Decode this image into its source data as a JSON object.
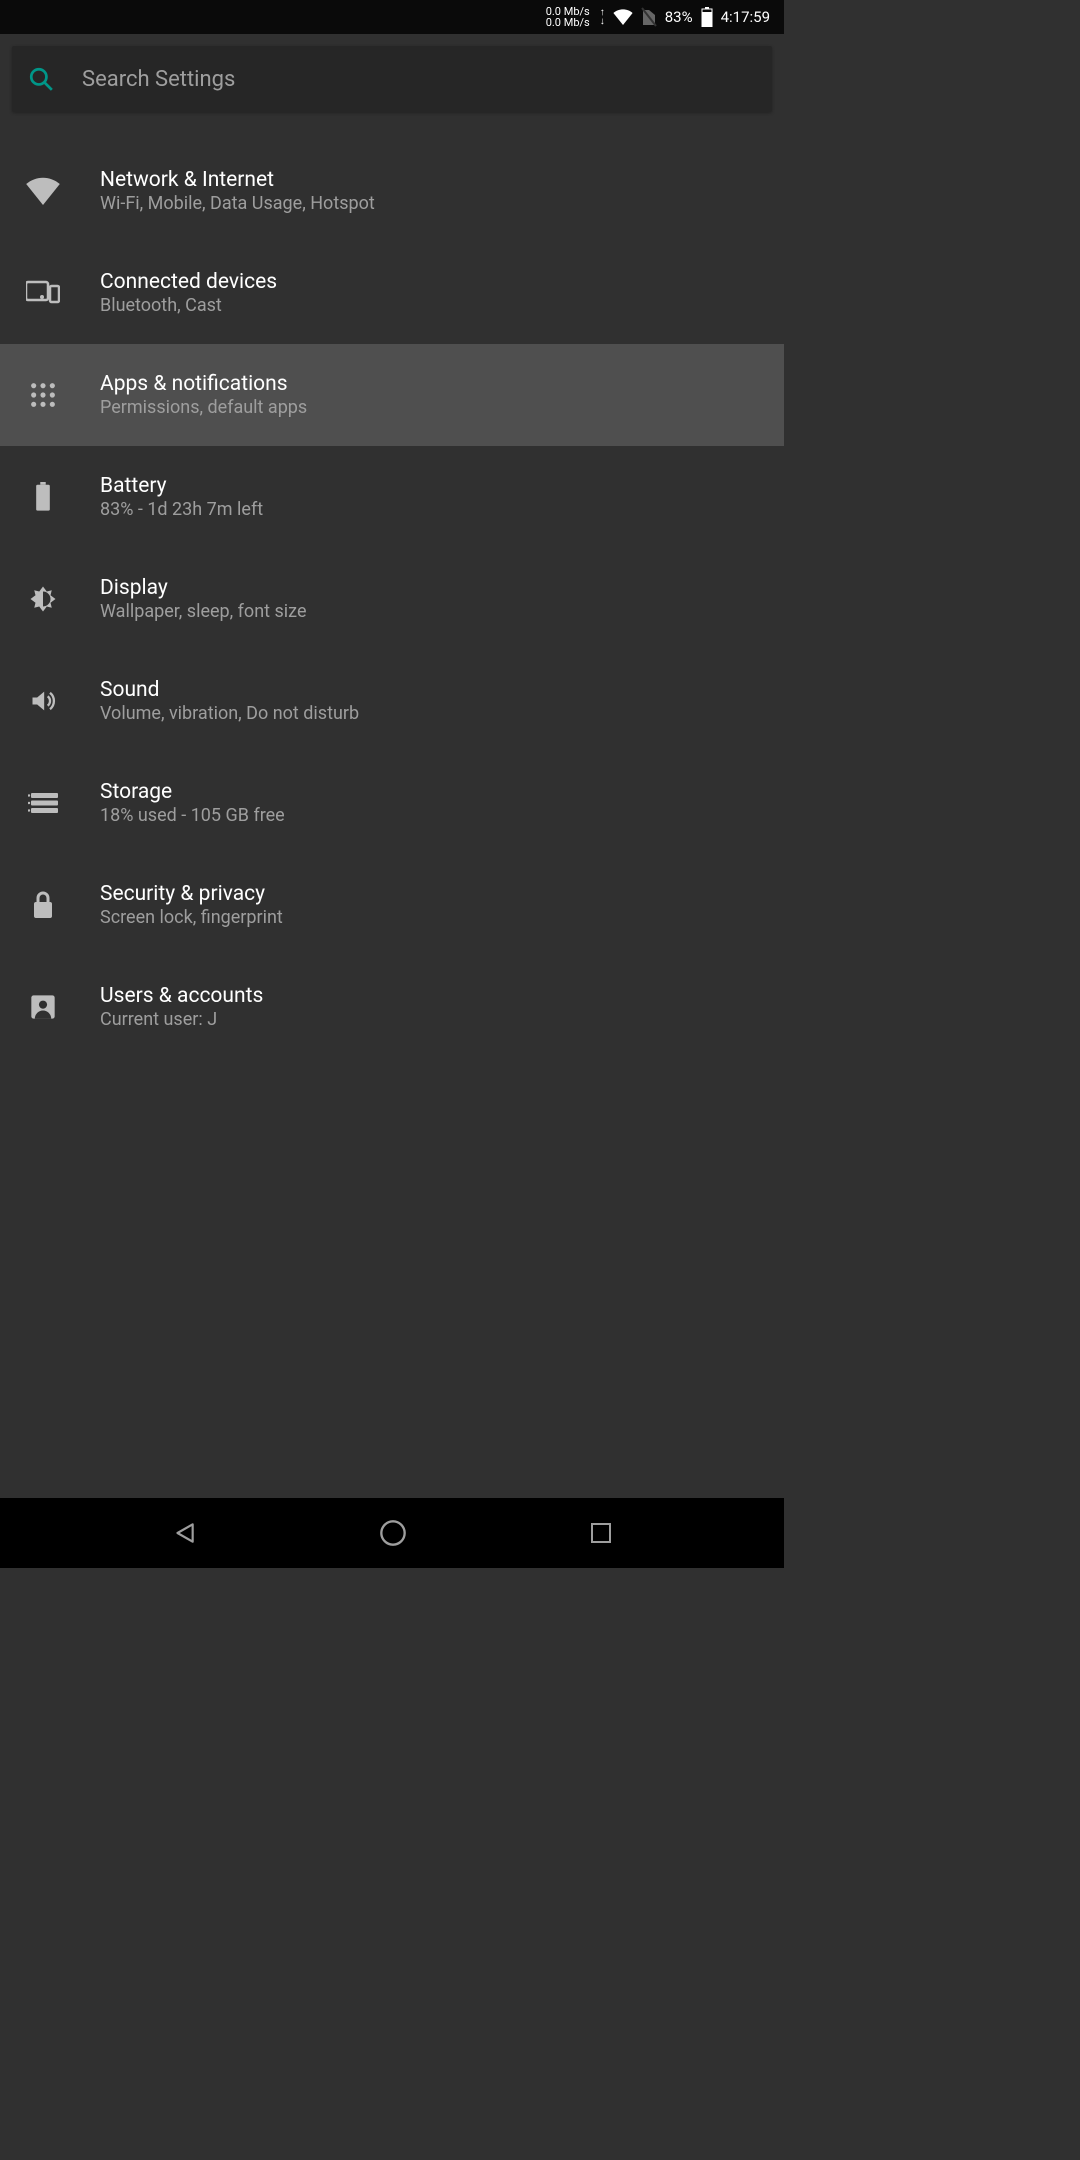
{
  "status_bar": {
    "data_up": "0.0 Mb/s",
    "data_down": "0.0 Mb/s",
    "battery_pct": "83%",
    "time": "4:17:59"
  },
  "search": {
    "placeholder": "Search Settings"
  },
  "items": [
    {
      "icon": "wifi",
      "title": "Network & Internet",
      "sub": "Wi-Fi, Mobile, Data Usage, Hotspot",
      "highlighted": false
    },
    {
      "icon": "devices",
      "title": "Connected devices",
      "sub": "Bluetooth, Cast",
      "highlighted": false
    },
    {
      "icon": "apps",
      "title": "Apps & notifications",
      "sub": "Permissions, default apps",
      "highlighted": true
    },
    {
      "icon": "battery",
      "title": "Battery",
      "sub": "83% - 1d 23h 7m left",
      "highlighted": false
    },
    {
      "icon": "display",
      "title": "Display",
      "sub": "Wallpaper, sleep, font size",
      "highlighted": false
    },
    {
      "icon": "sound",
      "title": "Sound",
      "sub": "Volume, vibration, Do not disturb",
      "highlighted": false
    },
    {
      "icon": "storage",
      "title": "Storage",
      "sub": "18% used - 105 GB free",
      "highlighted": false
    },
    {
      "icon": "security",
      "title": "Security & privacy",
      "sub": "Screen lock, fingerprint",
      "highlighted": false
    },
    {
      "icon": "users",
      "title": "Users & accounts",
      "sub": "Current user: J",
      "highlighted": false
    }
  ]
}
